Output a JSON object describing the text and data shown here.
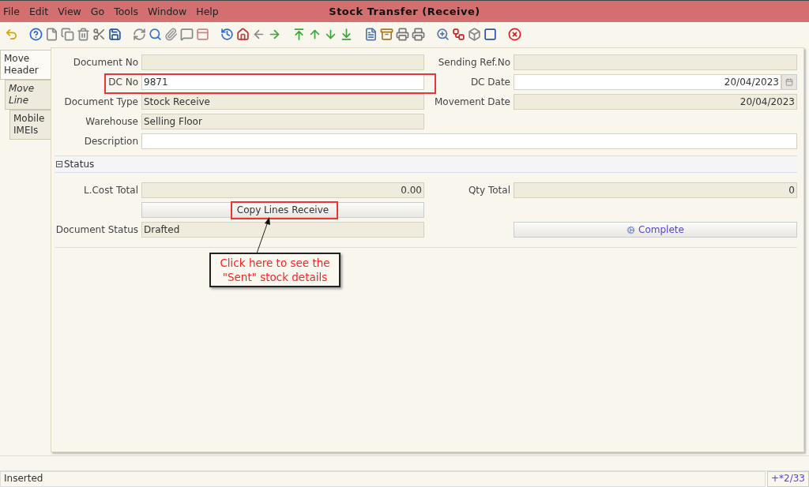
{
  "window": {
    "title": "Stock Transfer (Receive)"
  },
  "menu": [
    "File",
    "Edit",
    "View",
    "Go",
    "Tools",
    "Window",
    "Help"
  ],
  "tabs": [
    {
      "label": "Move Header",
      "selected": true,
      "italic": false
    },
    {
      "label": "Move Line",
      "selected": false,
      "italic": true
    },
    {
      "label": "Mobile IMEIs",
      "selected": false,
      "italic": false
    }
  ],
  "header_fields": [
    {
      "label": "Document No",
      "readonly": true,
      "kind": "text"
    },
    {
      "label": "Sending Ref.No",
      "readonly": true,
      "kind": "text"
    },
    {
      "label": "DC No",
      "value": "9871",
      "readonly": false,
      "kind": "text"
    },
    {
      "label": "DC Date",
      "value": "20/04/2023",
      "readonly": false,
      "kind": "date"
    },
    {
      "label": "Document Type",
      "value": "Stock Receive",
      "readonly": true,
      "kind": "text"
    },
    {
      "label": "Movement Date",
      "value": "20/04/2023",
      "readonly": true,
      "kind": "number"
    },
    {
      "label": "Warehouse",
      "value": "Selling Floor",
      "readonly": true,
      "kind": "text"
    },
    {
      "label": "Description",
      "readonly": false,
      "kind": "wide"
    }
  ],
  "status_section": {
    "title": "Status",
    "expanded": true,
    "lcost_total": {
      "label": "L.Cost Total",
      "value": "0.00"
    },
    "qty_total": {
      "label": "Qty Total",
      "value": "0"
    },
    "copy_button": "Copy Lines Receive",
    "document_status": {
      "label": "Document Status",
      "value": "Drafted"
    },
    "complete_button": "Complete"
  },
  "callout": "Click here to see the \"Sent\" stock details",
  "status_bar": {
    "message": "Inserted",
    "record": "+*2/33"
  }
}
